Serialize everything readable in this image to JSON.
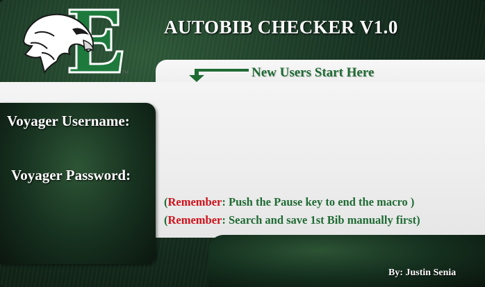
{
  "header": {
    "title": "AUTOBIB CHECKER V1.0",
    "logo_letter": "E",
    "logo_mark": "TM"
  },
  "start_link": {
    "label": "New Users Start Here",
    "icon": "arrow-down-left-icon"
  },
  "form": {
    "username_label": "Voyager Username:",
    "username_value": "",
    "password_label": "Voyager Password:",
    "password_value": ""
  },
  "reminders": [
    {
      "open": "(",
      "keyword": "Remember",
      "text": ": Push the Pause key to end the macro   )"
    },
    {
      "open": "(",
      "keyword": "Remember",
      "text": ": Search and save 1st Bib manually first)"
    }
  ],
  "footer": {
    "author": "By: Justin Senia"
  },
  "colors": {
    "brand_green": "#1f6b34",
    "accent_red": "#d0111a",
    "dark_green": "#173222"
  }
}
